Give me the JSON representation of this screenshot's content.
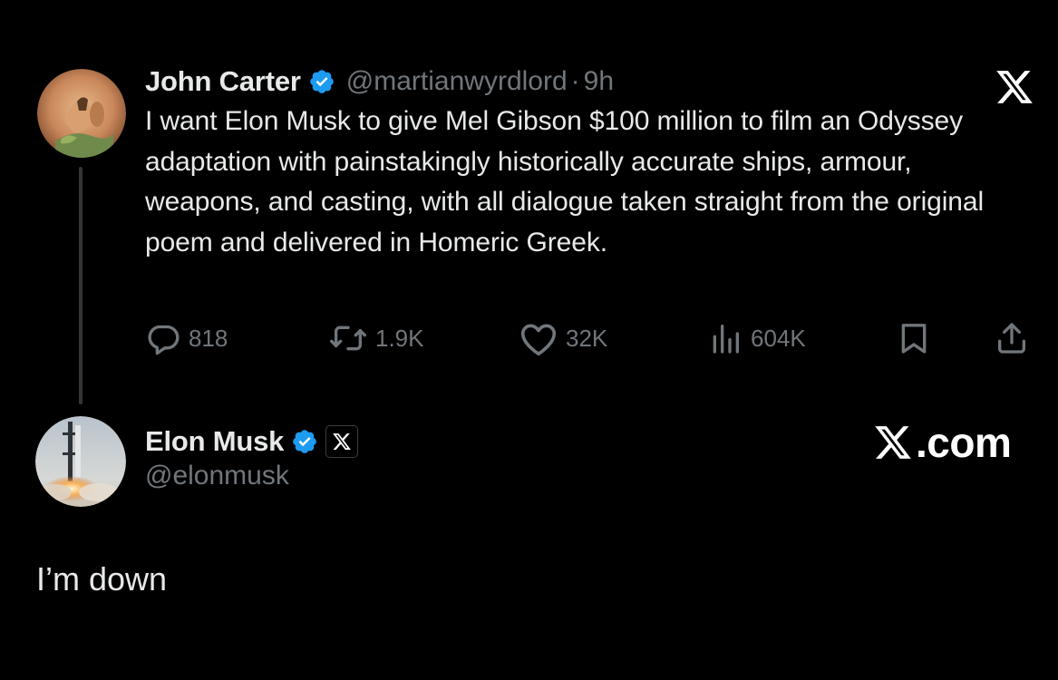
{
  "original_tweet": {
    "author": {
      "name": "John Carter",
      "handle": "@martianwyrdlord",
      "verified": true
    },
    "separator": "·",
    "time": "9h",
    "text": "I want Elon Musk to give Mel Gibson $100 million to film an Odyssey adaptation with painstakingly historically accurate ships, armour, weapons, and casting, with all dialogue taken straight from the original poem and delivered in Homeric Greek.",
    "stats": {
      "replies": "818",
      "reposts": "1.9K",
      "likes": "32K",
      "views": "604K"
    }
  },
  "reply": {
    "author": {
      "name": "Elon Musk",
      "handle": "@elonmusk",
      "verified": true,
      "affiliate_badge": "X"
    },
    "text": "I’m down"
  },
  "branding": {
    "watermark": "X.com",
    "watermark_suffix": ".com"
  },
  "colors": {
    "background": "#000000",
    "text_primary": "#e7e9ea",
    "text_secondary": "#71767b",
    "verified_blue": "#1d9bf0",
    "thread_line": "#333639"
  },
  "icons": {
    "reply": "speech-bubble-icon",
    "repost": "repost-arrows-icon",
    "like": "heart-icon",
    "views": "bar-chart-icon",
    "bookmark": "bookmark-icon",
    "share": "share-upload-icon",
    "brand": "x-logo-icon"
  }
}
